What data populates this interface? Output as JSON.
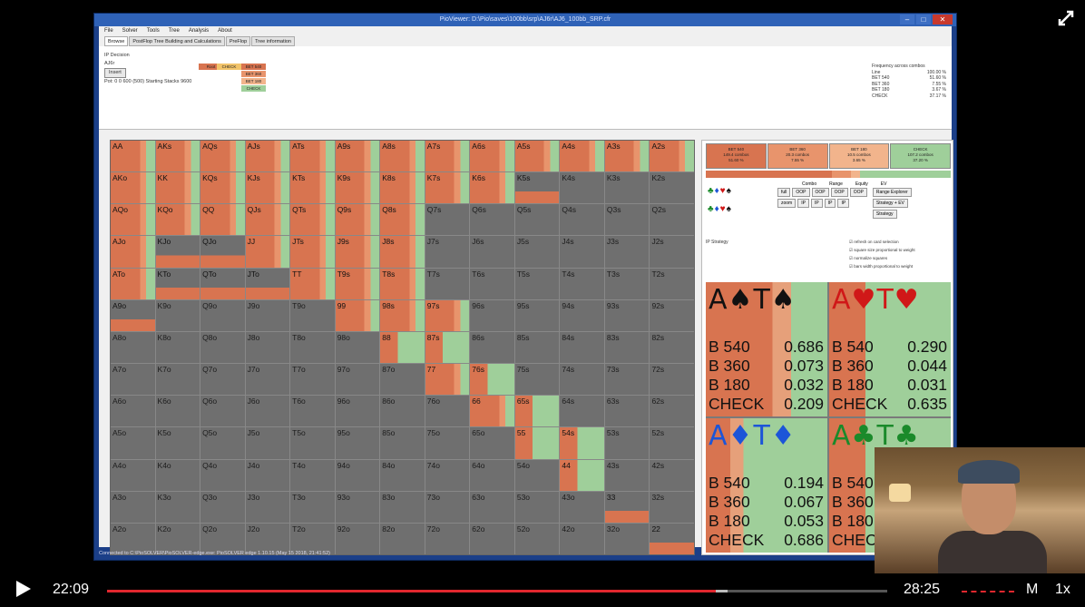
{
  "video": {
    "current_time": "22:09",
    "duration": "28:25",
    "played_fraction": 0.78,
    "mode_button": "M",
    "speed": "1x"
  },
  "app": {
    "window_title": "PioViewer: D:\\Pio\\saves\\100bb\\srp\\AJ6r\\AJ6_100bb_SRP.cfr",
    "menu": [
      "File",
      "Solver",
      "Tools",
      "Tree",
      "Analysis",
      "About"
    ],
    "tabs": [
      "Browse",
      "PostFlop Tree Building and Calculations",
      "PreFlop",
      "Tree information"
    ],
    "decision_label": "IP Decision",
    "board": "AJ6r",
    "insert_label": "Insert",
    "position_info": "Pot: 0 0 600 (500) Starting Stacks 9600",
    "tree": {
      "col1": [
        "Root"
      ],
      "col2": [
        "CHECK"
      ],
      "col3": [
        "BET 540",
        "BET 360",
        "BET 180",
        "CHECK"
      ]
    },
    "frequency": {
      "title": "Frequency across combos",
      "lines": [
        {
          "label": "Line",
          "value": "100.00 %"
        },
        {
          "label": "BET 540",
          "value": "51.60 %"
        },
        {
          "label": "BET 360",
          "value": "7.55 %"
        },
        {
          "label": "BET 180",
          "value": "3.67 %"
        },
        {
          "label": "CHECK",
          "value": "37.17 %"
        }
      ]
    },
    "status_bar": "Connected to C:\\PioSOLVER\\PioSOLVER-edge.exe: PioSOLVER edge 1.10.15 (May 15 2018, 21:41:52)",
    "colors": {
      "bet": "#d87450",
      "check": "#9fcf9a",
      "fold": "#6f6f6f"
    }
  },
  "grid": {
    "rows": [
      [
        "AA",
        "AKs",
        "AQs",
        "AJs",
        "ATs",
        "A9s",
        "A8s",
        "A7s",
        "A6s",
        "A5s",
        "A4s",
        "A3s",
        "A2s"
      ],
      [
        "AKo",
        "KK",
        "KQs",
        "KJs",
        "KTs",
        "K9s",
        "K8s",
        "K7s",
        "K6s",
        "K5s",
        "K4s",
        "K3s",
        "K2s"
      ],
      [
        "AQo",
        "KQo",
        "QQ",
        "QJs",
        "QTs",
        "Q9s",
        "Q8s",
        "Q7s",
        "Q6s",
        "Q5s",
        "Q4s",
        "Q3s",
        "Q2s"
      ],
      [
        "AJo",
        "KJo",
        "QJo",
        "JJ",
        "JTs",
        "J9s",
        "J8s",
        "J7s",
        "J6s",
        "J5s",
        "J4s",
        "J3s",
        "J2s"
      ],
      [
        "ATo",
        "KTo",
        "QTo",
        "JTo",
        "TT",
        "T9s",
        "T8s",
        "T7s",
        "T6s",
        "T5s",
        "T4s",
        "T3s",
        "T2s"
      ],
      [
        "A9o",
        "K9o",
        "Q9o",
        "J9o",
        "T9o",
        "99",
        "98s",
        "97s",
        "96s",
        "95s",
        "94s",
        "93s",
        "92s"
      ],
      [
        "A8o",
        "K8o",
        "Q8o",
        "J8o",
        "T8o",
        "98o",
        "88",
        "87s",
        "86s",
        "85s",
        "84s",
        "83s",
        "82s"
      ],
      [
        "A7o",
        "K7o",
        "Q7o",
        "J7o",
        "T7o",
        "97o",
        "87o",
        "77",
        "76s",
        "75s",
        "74s",
        "73s",
        "72s"
      ],
      [
        "A6o",
        "K6o",
        "Q6o",
        "J6o",
        "T6o",
        "96o",
        "86o",
        "76o",
        "66",
        "65s",
        "64s",
        "63s",
        "62s"
      ],
      [
        "A5o",
        "K5o",
        "Q5o",
        "J5o",
        "T5o",
        "95o",
        "85o",
        "75o",
        "65o",
        "55",
        "54s",
        "53s",
        "52s"
      ],
      [
        "A4o",
        "K4o",
        "Q4o",
        "J4o",
        "T4o",
        "94o",
        "84o",
        "74o",
        "64o",
        "54o",
        "44",
        "43s",
        "42s"
      ],
      [
        "A3o",
        "K3o",
        "Q3o",
        "J3o",
        "T3o",
        "93o",
        "83o",
        "73o",
        "63o",
        "53o",
        "43o",
        "33",
        "32s"
      ],
      [
        "A2o",
        "K2o",
        "Q2o",
        "J2o",
        "T2o",
        "92o",
        "82o",
        "72o",
        "62o",
        "52o",
        "42o",
        "32o",
        "22"
      ]
    ]
  },
  "right_panel": {
    "actions": [
      {
        "label": "BET 540",
        "combos": "149.4 combos",
        "pct": "51.60 %",
        "color": "#d87450"
      },
      {
        "label": "BET 360",
        "combos": "20.3 combos",
        "pct": "7.55 %",
        "color": "#e8946c"
      },
      {
        "label": "BET 180",
        "combos": "10.5 combos",
        "pct": "3.65 %",
        "color": "#f2b48c"
      },
      {
        "label": "CHECK",
        "combos": "107.2 combos",
        "pct": "37.20 %",
        "color": "#9fcf9a"
      }
    ],
    "bar_fractions": [
      0.516,
      0.0755,
      0.0365,
      0.372
    ],
    "controls": {
      "header": [
        "Combo",
        "Range",
        "Equity",
        "EV"
      ],
      "row1": [
        "full",
        "OOP",
        "OOP",
        "OOP",
        "OOP"
      ],
      "row2": [
        "zoom",
        "IP",
        "IP",
        "IP",
        "IP"
      ],
      "range_explorer": "Range Explorer",
      "strategy_ev": "Strategy + EV",
      "strategy": "Strategy"
    },
    "ip_strategy_label": "IP Strategy",
    "options": [
      "refresh on card selection",
      "square size proportional to weight",
      "normalize squares",
      "bars width proportional to weight"
    ]
  },
  "combos": [
    {
      "rank1": "A",
      "suit": "♠",
      "rank2": "T",
      "color": "#111111",
      "values": [
        {
          "label": "B 540",
          "value": "0.686"
        },
        {
          "label": "B 360",
          "value": "0.073"
        },
        {
          "label": "B 180",
          "value": "0.032"
        },
        {
          "label": "CHECK",
          "value": "0.209"
        }
      ]
    },
    {
      "rank1": "A",
      "suit": "♥",
      "rank2": "T",
      "color": "#d01818",
      "values": [
        {
          "label": "B 540",
          "value": "0.290"
        },
        {
          "label": "B 360",
          "value": "0.044"
        },
        {
          "label": "B 180",
          "value": "0.031"
        },
        {
          "label": "CHECK",
          "value": "0.635"
        }
      ]
    },
    {
      "rank1": "A",
      "suit": "♦",
      "rank2": "T",
      "color": "#1c55d8",
      "values": [
        {
          "label": "B 540",
          "value": "0.194"
        },
        {
          "label": "B 360",
          "value": "0.067"
        },
        {
          "label": "B 180",
          "value": "0.053"
        },
        {
          "label": "CHECK",
          "value": "0.686"
        }
      ]
    },
    {
      "rank1": "A",
      "suit": "♣",
      "rank2": "T",
      "color": "#1a8a2a",
      "values": [
        {
          "label": "B 540",
          "value": ""
        },
        {
          "label": "B 360",
          "value": ""
        },
        {
          "label": "B 180",
          "value": ""
        },
        {
          "label": "CHECK",
          "value": ""
        }
      ]
    }
  ]
}
